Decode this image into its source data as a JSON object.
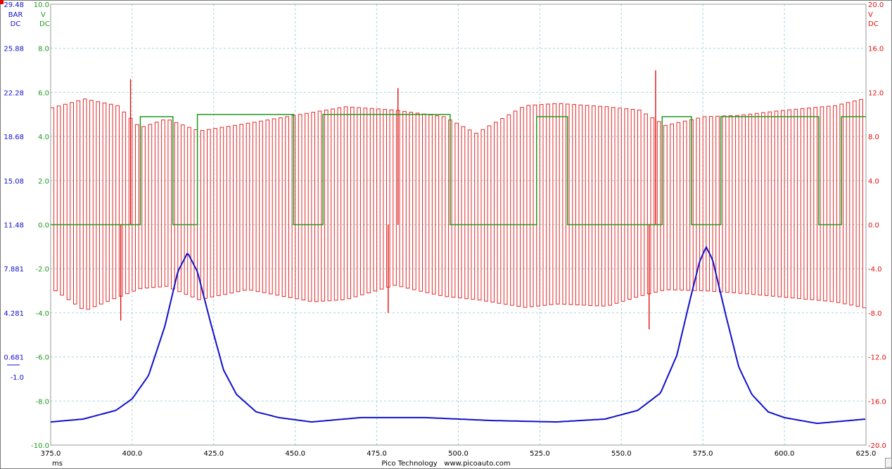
{
  "footer": {
    "brand": "Pico Technology",
    "url": "www.picoauto.com",
    "x_unit": "ms"
  },
  "colors": {
    "channel_a": "#1010cc",
    "channel_b": "#1e9a1e",
    "channel_c": "#e01010",
    "grid": "#a8d4dc"
  },
  "chart_data": {
    "type": "line",
    "title": "",
    "xlabel": "ms",
    "xlim": [
      375.0,
      625.0
    ],
    "x_ticks": [
      "375.0",
      "400.0",
      "425.0",
      "450.0",
      "475.0",
      "500.0",
      "525.0",
      "550.0",
      "575.0",
      "600.0",
      "625.0"
    ],
    "grid": true,
    "axes": [
      {
        "id": "pressure",
        "side": "left",
        "unit": "BAR",
        "coupling": "DC",
        "color": "#1010cc",
        "ylim": [
          -1.0,
          29.48
        ],
        "tick_labels": [
          "29.48",
          "25.88",
          "22.28",
          "18.68",
          "15.08",
          "11.48",
          "7.881",
          "4.281",
          "0.681",
          "-1.0"
        ]
      },
      {
        "id": "volts_b",
        "side": "left",
        "unit": "V",
        "coupling": "DC",
        "color": "#1e9a1e",
        "ylim": [
          -10.0,
          10.0
        ],
        "tick_labels": [
          "10.0",
          "8.0",
          "6.0",
          "4.0",
          "2.0",
          "0.0",
          "-2.0",
          "-4.0",
          "-6.0",
          "-8.0",
          "-10.0"
        ]
      },
      {
        "id": "volts_c",
        "side": "right",
        "unit": "V",
        "coupling": "DC",
        "color": "#e01010",
        "ylim": [
          -20.0,
          20.0
        ],
        "tick_labels": [
          "20.0",
          "16.0",
          "12.0",
          "8.0",
          "4.0",
          "0.0",
          "-4.0",
          "-8.0",
          "-12.0",
          "-16.0",
          "-20.0"
        ]
      }
    ],
    "series": [
      {
        "axis": "pressure",
        "color": "#1010cc",
        "x": [
          375,
          385,
          395,
          400,
          405,
          410,
          414,
          417,
          420,
          424,
          428,
          432,
          438,
          445,
          455,
          470,
          490,
          510,
          530,
          545,
          555,
          562,
          567,
          571,
          574,
          576,
          578,
          582,
          586,
          590,
          595,
          600,
          610,
          625
        ],
        "y": [
          0.6,
          0.8,
          1.4,
          2.2,
          3.8,
          7.2,
          11.0,
          12.3,
          11.0,
          7.5,
          4.2,
          2.5,
          1.3,
          0.9,
          0.6,
          0.9,
          0.9,
          0.7,
          0.6,
          0.8,
          1.4,
          2.6,
          5.2,
          9.0,
          11.7,
          12.7,
          11.8,
          8.0,
          4.4,
          2.5,
          1.3,
          0.9,
          0.5,
          0.8
        ]
      },
      {
        "axis": "volts_b",
        "color": "#1e9a1e",
        "segments": [
          [
            375.0,
            402.5,
            0.0
          ],
          [
            402.5,
            412.5,
            4.9
          ],
          [
            412.5,
            420.0,
            0.0
          ],
          [
            420.0,
            449.5,
            5.0
          ],
          [
            449.5,
            458.5,
            0.0
          ],
          [
            458.5,
            497.5,
            5.0
          ],
          [
            497.5,
            524.0,
            0.0
          ],
          [
            524.0,
            533.5,
            4.9
          ],
          [
            533.5,
            562.5,
            0.0
          ],
          [
            562.5,
            571.5,
            4.9
          ],
          [
            571.5,
            580.5,
            0.0
          ],
          [
            580.5,
            610.5,
            4.9
          ],
          [
            610.5,
            617.5,
            0.0
          ],
          [
            617.5,
            625.0,
            4.9
          ]
        ]
      },
      {
        "axis": "volts_c",
        "color": "#e01010",
        "waveform": "square",
        "period_ms": 2.0,
        "envelope": {
          "x": [
            375,
            385,
            395,
            402,
            410,
            420,
            435,
            455,
            465,
            480,
            495,
            505,
            520,
            530,
            545,
            555,
            563,
            575,
            585,
            600,
            615,
            625
          ],
          "max": [
            10.6,
            11.4,
            10.8,
            8.8,
            9.6,
            8.5,
            9.2,
            10.2,
            10.7,
            10.4,
            9.8,
            8.3,
            10.8,
            11.0,
            10.7,
            10.4,
            9.0,
            9.8,
            9.9,
            10.4,
            10.8,
            11.5
          ],
          "min": [
            -5.8,
            -7.8,
            -6.6,
            -5.8,
            -5.6,
            -6.8,
            -5.9,
            -7.0,
            -6.8,
            -5.5,
            -6.5,
            -6.8,
            -7.5,
            -7.2,
            -7.4,
            -6.5,
            -5.9,
            -6.0,
            -6.2,
            -6.6,
            -7.0,
            -7.6
          ]
        },
        "spikes": [
          {
            "x": 396.5,
            "y": -8.7
          },
          {
            "x": 399.5,
            "y": 13.2
          },
          {
            "x": 478.5,
            "y": -8.0
          },
          {
            "x": 481.5,
            "y": 12.4
          },
          {
            "x": 558.5,
            "y": -9.5
          },
          {
            "x": 560.5,
            "y": 14.0
          }
        ]
      }
    ]
  }
}
